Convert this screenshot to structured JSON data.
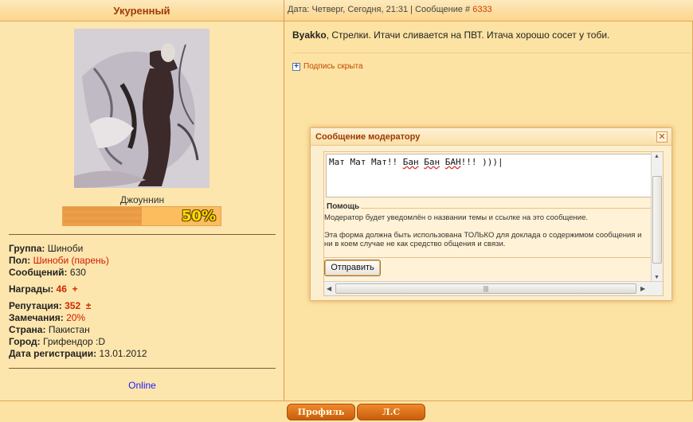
{
  "author": {
    "name": "Укуренный",
    "rank_title": "Джоуннин",
    "progress_label": "50%",
    "progress_fraction": 0.5,
    "fields": {
      "group_label": "Группа:",
      "group_value": "Шиноби",
      "gender_label": "Пол:",
      "gender_value": "Шиноби (парень)",
      "posts_label": "Сообщений:",
      "posts_value": "630",
      "awards_label": "Награды:",
      "awards_value": "46",
      "awards_plus": "+",
      "rep_label": "Репутация:",
      "rep_value": "352",
      "rep_pm": "±",
      "warn_label": "Замечания:",
      "warn_value": "20%",
      "country_label": "Страна:",
      "country_value": "Пакистан",
      "city_label": "Город:",
      "city_value": "Грифендор :D",
      "reg_label": "Дата регистрации:",
      "reg_value": "13.01.2012"
    },
    "status": "Online"
  },
  "post": {
    "header_prefix": "Дата: Четверг, Сегодня, 21:31 | Сообщение #",
    "post_number": "6333",
    "reply_name": "Byakko",
    "body_text": ", Стрелки. Итачи сливается на ПВТ. Итача хорошо сосет у тоби.",
    "signature_toggle": "Подпись скрыта"
  },
  "footer": {
    "profile_button": "Профиль",
    "pm_button": "Л.С"
  },
  "modal": {
    "title": "Сообщение модератору",
    "close_glyph": "✕",
    "textarea_part1": "Мат Мат Мат!! ",
    "textarea_ban1": "Бан",
    "textarea_ban2": "Бан",
    "textarea_ban3": "БАН",
    "textarea_tail": "!!! )))",
    "help_title": "Помощь",
    "help_line1": "Модератор будет уведомлён о названии темы и ссылке на это сообщение.",
    "help_line2": "Эта форма должна быть использована ТОЛЬКО для доклада о содержимом сообщения и",
    "help_line3": "ни в коем случае не как средство общения и связи.",
    "send_button": "Отправить"
  },
  "icons": {
    "expand": "plus-box",
    "close": "close-x"
  },
  "colors": {
    "page_bg": "#fde3a3",
    "accent_red": "#d21a00",
    "button_orange": "#e07420",
    "link_blue": "#1a1aff"
  }
}
